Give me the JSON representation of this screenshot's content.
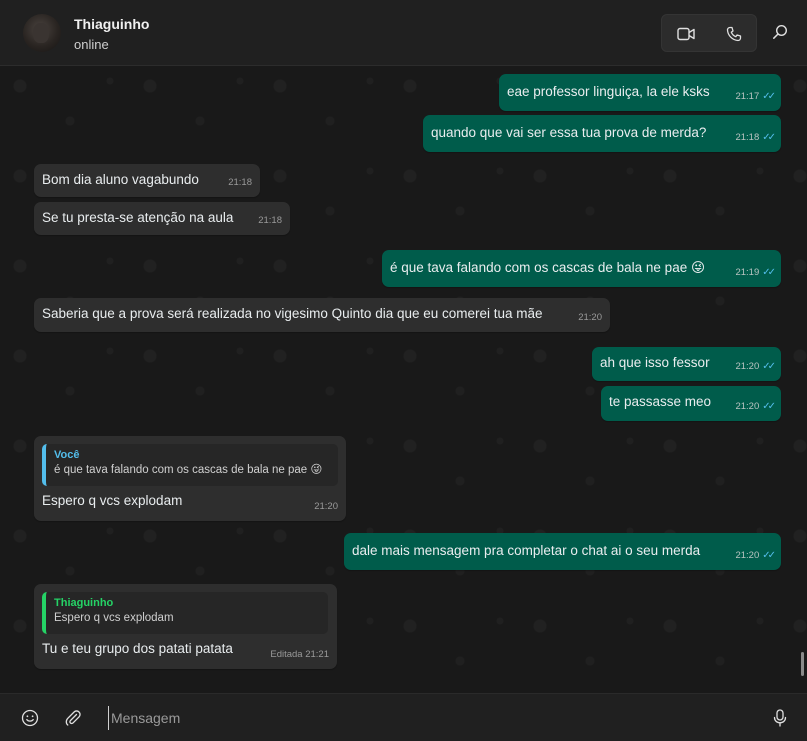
{
  "header": {
    "contact_name": "Thiaguinho",
    "status": "online",
    "icons": {
      "avatar": "contact-photo",
      "video": "video-call-icon",
      "phone": "voice-call-icon",
      "search": "search-icon"
    }
  },
  "messages": [
    {
      "dir": "out",
      "text": "eae professor linguiça, la ele ksks",
      "time": "21:17",
      "read": true
    },
    {
      "dir": "out",
      "text": "quando que vai ser essa tua prova de merda?",
      "time": "21:18",
      "read": true
    },
    {
      "dir": "in",
      "text": "Bom dia aluno vagabundo",
      "time": "21:18"
    },
    {
      "dir": "in",
      "text": "Se tu presta-se atenção na aula",
      "time": "21:18"
    },
    {
      "dir": "out",
      "text": "é que tava falando com os cascas de bala ne pae 😜",
      "time": "21:19",
      "read": true
    },
    {
      "dir": "in",
      "text": "Saberia que a prova será realizada no vigesimo Quinto dia que eu comerei tua mãe",
      "time": "21:20"
    },
    {
      "dir": "out",
      "text": "ah que isso fessor",
      "time": "21:20",
      "read": true
    },
    {
      "dir": "out",
      "text": "te passasse meo",
      "time": "21:20",
      "read": true
    },
    {
      "dir": "in",
      "text": "Espero q vcs explodam",
      "time": "21:20",
      "quote": {
        "author": "Você",
        "text": "é que tava falando com os cascas de bala ne pae 😜",
        "color": "#53bdeb"
      }
    },
    {
      "dir": "out",
      "text": "dale mais mensagem pra completar o chat ai o seu merda",
      "time": "21:20",
      "read": true
    },
    {
      "dir": "in",
      "text": "Tu e teu grupo dos patati patata",
      "time": "Editada 21:21",
      "quote": {
        "author": "Thiaguinho",
        "text": "Espero q vcs explodam",
        "color": "#25d366"
      }
    }
  ],
  "read_ticks": "✓✓",
  "composer": {
    "placeholder": "Mensagem",
    "icons": {
      "emoji": "emoji-icon",
      "attach": "paperclip-icon",
      "mic": "microphone-icon"
    }
  },
  "colors": {
    "outgoing": "#005c4b",
    "incoming": "#2e2e2e",
    "tick": "#53bdeb",
    "background": "#191919"
  }
}
